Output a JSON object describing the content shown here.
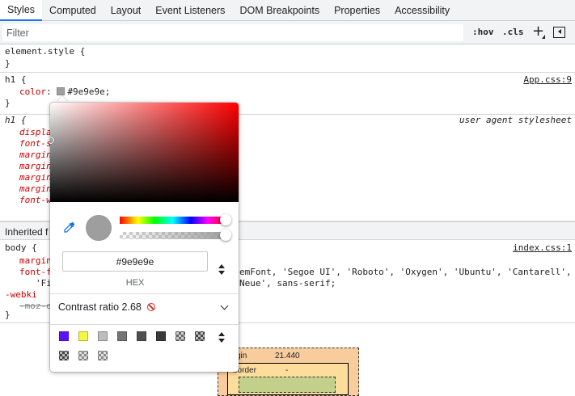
{
  "tabs": [
    "Styles",
    "Computed",
    "Layout",
    "Event Listeners",
    "DOM Breakpoints",
    "Properties",
    "Accessibility"
  ],
  "filter": {
    "placeholder": "Filter",
    "hov": ":hov",
    "cls": ".cls"
  },
  "element_style": {
    "selector": "element.style {",
    "close": "}"
  },
  "h1_rule": {
    "selector": "h1 {",
    "property": "color",
    "value": "#9e9e9e;",
    "source": "App.css:9",
    "close": "}"
  },
  "ua_rule": {
    "selector": "h1 {",
    "origin": "user agent stylesheet",
    "props": [
      "displa",
      "font-s",
      "margin",
      "margin",
      "margin",
      "margin",
      "font-w"
    ]
  },
  "inherited": {
    "label": "Inherited f"
  },
  "body_rule": {
    "selector": "body {",
    "source": "index.css:1",
    "prop_margin": "margin",
    "prop_font": "font-f",
    "font_cont1": "emFont, 'Segoe UI', 'Roboto', 'Oxygen', 'Ubuntu', 'Cantarell',",
    "font_cont2": "'Fi",
    "font_cont3": "Neue', sans-serif;",
    "prop_webkit": "-webki",
    "prop_moz": "-moz-o",
    "close": "}"
  },
  "box_model": {
    "margin_label": "gin",
    "margin_value": "21.440",
    "border_label": "border",
    "border_value": "-"
  },
  "picker": {
    "current_color": "#9e9e9e",
    "hex_value": "#9e9e9e",
    "format_label": "HEX",
    "contrast_label": "Contrast ratio",
    "contrast_value": "2.68",
    "palette": [
      "#5e0fff",
      "#f5f542",
      "#bdbdbd",
      "#757575",
      "#4f4f4f",
      "#3a3a3a",
      "checker-dark",
      "checker-darker",
      "checker-mid",
      "checker-light",
      "checker-light"
    ]
  },
  "colors": {
    "accent": "#1a73e8",
    "property": "#c80000",
    "warning": "#d93025"
  }
}
